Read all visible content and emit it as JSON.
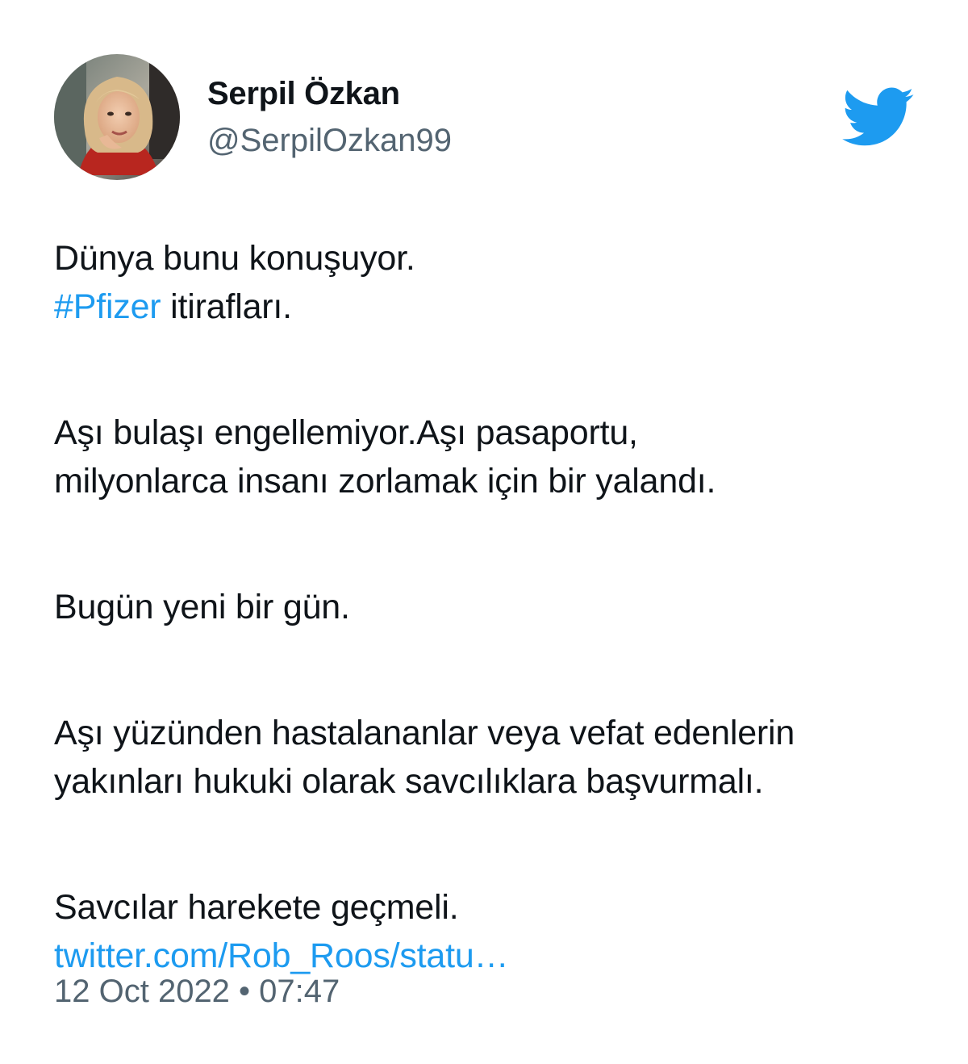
{
  "author": {
    "name": "Serpil Özkan",
    "handle": "@SerpilOzkan99",
    "avatar_icon": "profile-photo"
  },
  "brand": {
    "icon": "twitter-bird-icon",
    "color": "#1d9bf0"
  },
  "tweet": {
    "line1": "Dünya bunu konuşuyor.",
    "hashtag": "#Pfizer",
    "line2_rest": " itirafları.",
    "line3": "Aşı bulaşı engellemiyor.Aşı pasaportu,",
    "line4": "milyonlarca insanı zorlamak için bir yalandı.",
    "line5": "Bugün yeni bir gün.",
    "line6": "Aşı yüzünden hastalananlar veya vefat edenlerin",
    "line7": "yakınları hukuki olarak savcılıklara başvurmalı.",
    "line8": "Savcılar harekete geçmeli.",
    "link": "twitter.com/Rob_Roos/statu…"
  },
  "timestamp": "12 Oct 2022 • 07:47",
  "colors": {
    "text": "#0f1419",
    "secondary": "#536471",
    "link": "#1d9bf0"
  }
}
